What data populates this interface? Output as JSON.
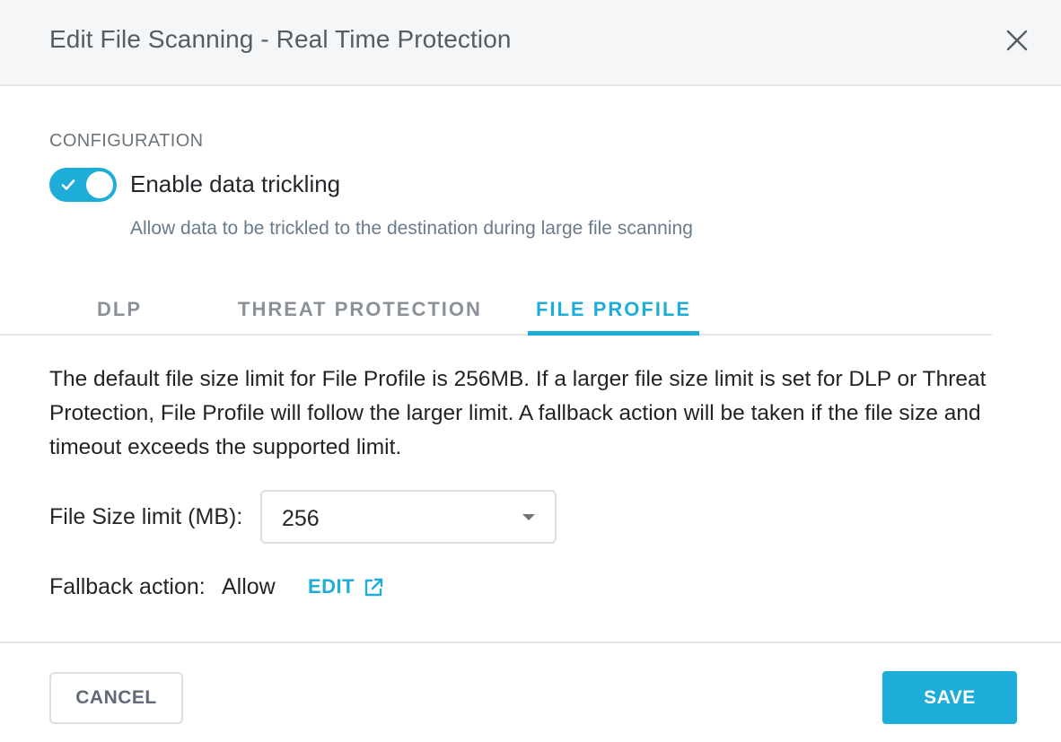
{
  "dialog": {
    "title": "Edit File Scanning - Real Time Protection",
    "close_icon": "close-icon"
  },
  "configuration": {
    "section_label": "CONFIGURATION",
    "toggle": {
      "label": "Enable data trickling",
      "enabled": true,
      "description": "Allow data to be trickled to the destination during large file scanning",
      "icon": "check-icon"
    }
  },
  "tabs": {
    "items": [
      {
        "label": "DLP",
        "active": false
      },
      {
        "label": "THREAT PROTECTION",
        "active": false
      },
      {
        "label": "FILE PROFILE",
        "active": true
      }
    ]
  },
  "file_profile": {
    "description": "The default file size limit for File Profile is 256MB. If a larger file size limit is set for DLP or Threat Protection, File Profile will follow the larger limit. A fallback action will be taken if the file size and timeout exceeds the supported limit.",
    "size_limit_label": "File Size limit (MB):",
    "size_limit_value": "256",
    "fallback_label": "Fallback action:",
    "fallback_value": "Allow",
    "edit_label": "EDIT",
    "edit_icon": "external-link-icon"
  },
  "footer": {
    "cancel_label": "CANCEL",
    "save_label": "SAVE"
  },
  "colors": {
    "accent": "#1eadd9",
    "header_bg": "#f5f6f7",
    "muted_text": "#6a7b8c"
  }
}
